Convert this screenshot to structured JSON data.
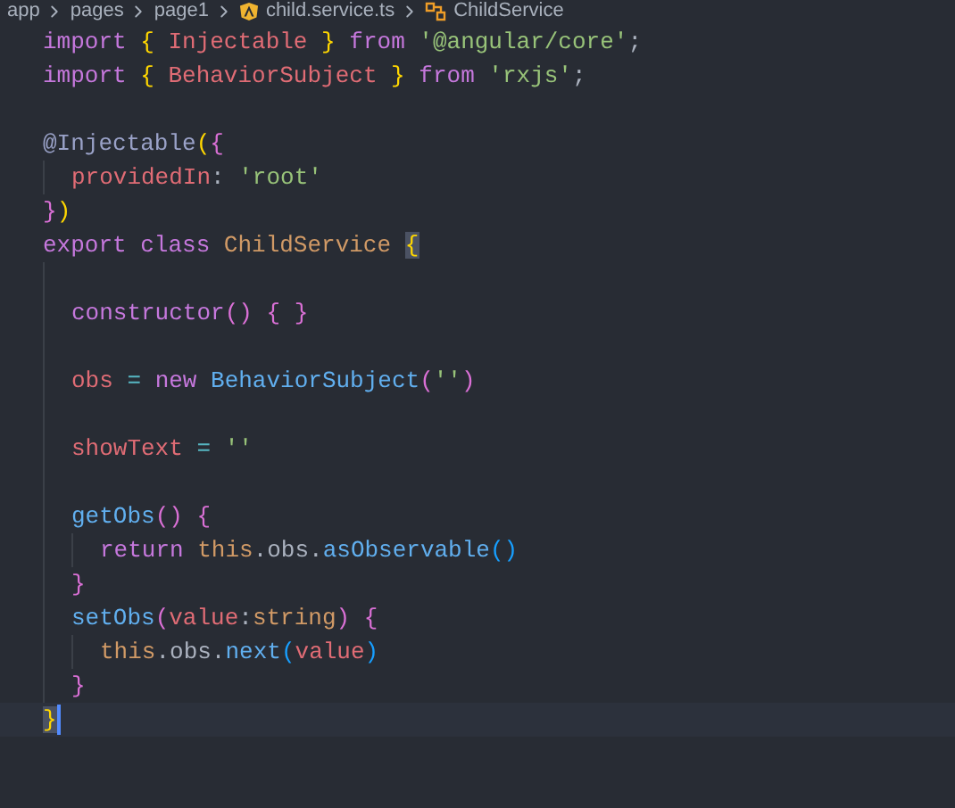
{
  "breadcrumb": [
    {
      "text": "app",
      "kind": "folder"
    },
    {
      "text": "pages",
      "kind": "folder"
    },
    {
      "text": "page1",
      "kind": "folder"
    },
    {
      "text": "child.service.ts",
      "kind": "file"
    },
    {
      "text": "ChildService",
      "kind": "symbol"
    }
  ],
  "lines": [
    {
      "tokens": [
        {
          "text": "import ",
          "kind": "kw"
        },
        {
          "text": "{",
          "kind": "b1"
        },
        {
          "text": " Injectable ",
          "kind": "prop"
        },
        {
          "text": "}",
          "kind": "b1"
        },
        {
          "text": " from ",
          "kind": "kw"
        },
        {
          "text": "'@angular/core'",
          "kind": "str"
        },
        {
          "text": ";",
          "kind": "plain"
        }
      ]
    },
    {
      "tokens": [
        {
          "text": "import ",
          "kind": "kw"
        },
        {
          "text": "{",
          "kind": "b1"
        },
        {
          "text": " BehaviorSubject ",
          "kind": "prop"
        },
        {
          "text": "}",
          "kind": "b1"
        },
        {
          "text": " from ",
          "kind": "kw"
        },
        {
          "text": "'rxjs'",
          "kind": "str"
        },
        {
          "text": ";",
          "kind": "plain"
        }
      ]
    },
    {
      "kind": "blank"
    },
    {
      "tokens": [
        {
          "text": "@Injectable",
          "kind": "deco"
        },
        {
          "text": "(",
          "kind": "b1"
        },
        {
          "text": "{",
          "kind": "b2"
        }
      ],
      "children": [
        {
          "tokens": [
            {
              "text": "providedIn",
              "kind": "prop"
            },
            {
              "text": ": ",
              "kind": "plain"
            },
            {
              "text": "'root'",
              "kind": "str"
            }
          ]
        }
      ]
    },
    {
      "tokens": [
        {
          "text": "}",
          "kind": "b2"
        },
        {
          "text": ")",
          "kind": "b1"
        }
      ]
    },
    {
      "tokens": [
        {
          "text": "export class ",
          "kind": "kw"
        },
        {
          "text": "ChildService ",
          "kind": "cls"
        },
        {
          "text": "{",
          "kind": "b1m"
        }
      ],
      "children": [
        {
          "kind": "blank"
        },
        {
          "tokens": [
            {
              "text": "constructor",
              "kind": "kw"
            },
            {
              "text": "() { }",
              "kind": "b2"
            }
          ]
        },
        {
          "kind": "blank"
        },
        {
          "tokens": [
            {
              "text": "obs",
              "kind": "prop"
            },
            {
              "text": " = ",
              "kind": "op"
            },
            {
              "text": "new ",
              "kind": "kw"
            },
            {
              "text": "BehaviorSubject",
              "kind": "fn"
            },
            {
              "text": "(",
              "kind": "b2"
            },
            {
              "text": "''",
              "kind": "str"
            },
            {
              "text": ")",
              "kind": "b2"
            }
          ]
        },
        {
          "kind": "blank"
        },
        {
          "tokens": [
            {
              "text": "showText",
              "kind": "prop"
            },
            {
              "text": " = ",
              "kind": "op"
            },
            {
              "text": "''",
              "kind": "str"
            }
          ]
        },
        {
          "kind": "blank"
        },
        {
          "tokens": [
            {
              "text": "getObs",
              "kind": "fn"
            },
            {
              "text": "() {",
              "kind": "b2"
            }
          ],
          "children": [
            {
              "tokens": [
                {
                  "text": "return ",
                  "kind": "kw"
                },
                {
                  "text": "this",
                  "kind": "cls"
                },
                {
                  "text": ".obs.",
                  "kind": "plain"
                },
                {
                  "text": "asObservable",
                  "kind": "fn"
                },
                {
                  "text": "()",
                  "kind": "b3"
                }
              ]
            }
          ]
        },
        {
          "tokens": [
            {
              "text": "}",
              "kind": "b2"
            }
          ]
        },
        {
          "tokens": [
            {
              "text": "setObs",
              "kind": "fn"
            },
            {
              "text": "(",
              "kind": "b2"
            },
            {
              "text": "value",
              "kind": "prop"
            },
            {
              "text": ":",
              "kind": "plain"
            },
            {
              "text": "string",
              "kind": "cls"
            },
            {
              "text": ") {",
              "kind": "b2"
            }
          ],
          "children": [
            {
              "tokens": [
                {
                  "text": "this",
                  "kind": "cls"
                },
                {
                  "text": ".obs.",
                  "kind": "plain"
                },
                {
                  "text": "next",
                  "kind": "fn"
                },
                {
                  "text": "(",
                  "kind": "b3"
                },
                {
                  "text": "value",
                  "kind": "prop"
                },
                {
                  "text": ")",
                  "kind": "b3"
                }
              ]
            }
          ]
        },
        {
          "tokens": [
            {
              "text": "}",
              "kind": "b2"
            }
          ]
        }
      ]
    },
    {
      "tokens": [
        {
          "text": "}",
          "kind": "b1m"
        }
      ],
      "current": true
    }
  ]
}
